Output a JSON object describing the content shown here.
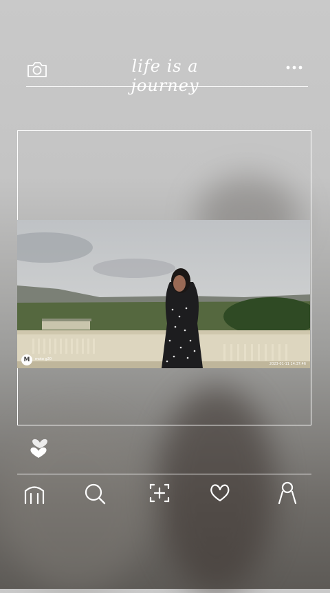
{
  "header": {
    "title": "life is a journey",
    "camera_icon": "camera-icon",
    "more_icon": "more-dots-icon"
  },
  "post": {
    "photo_description_icon": "photo",
    "watermark_brand": "moto g20",
    "watermark_date": "2023-01-11 14:37:46"
  },
  "actions": {
    "like_icon": "hearts-icon"
  },
  "bottom_nav": {
    "items": [
      {
        "icon": "home-icon"
      },
      {
        "icon": "search-icon"
      },
      {
        "icon": "add-post-icon"
      },
      {
        "icon": "heart-icon"
      },
      {
        "icon": "profile-icon"
      }
    ]
  },
  "colors": {
    "foreground": "#ffffff",
    "background_top": "#c9c9c9",
    "background_bottom": "#5d5a56"
  }
}
